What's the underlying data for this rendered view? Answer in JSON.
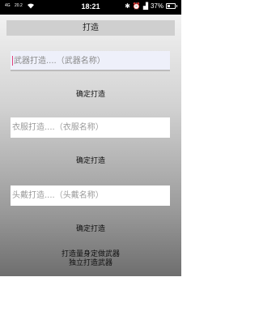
{
  "status_bar": {
    "network": "4G",
    "speed": "20.2",
    "time": "18:21",
    "battery": "37%"
  },
  "title": "打造",
  "weapon": {
    "placeholder": "武器打造....（武器名称）",
    "button": "确定打造"
  },
  "clothes": {
    "placeholder": "衣服打造....（衣服名称）",
    "button": "确定打造"
  },
  "helmet": {
    "placeholder": "头戴打造....（头戴名称）",
    "button": "确定打造"
  },
  "footer": {
    "line1": "打造量身定做武器",
    "line2": "独立打造武器"
  }
}
